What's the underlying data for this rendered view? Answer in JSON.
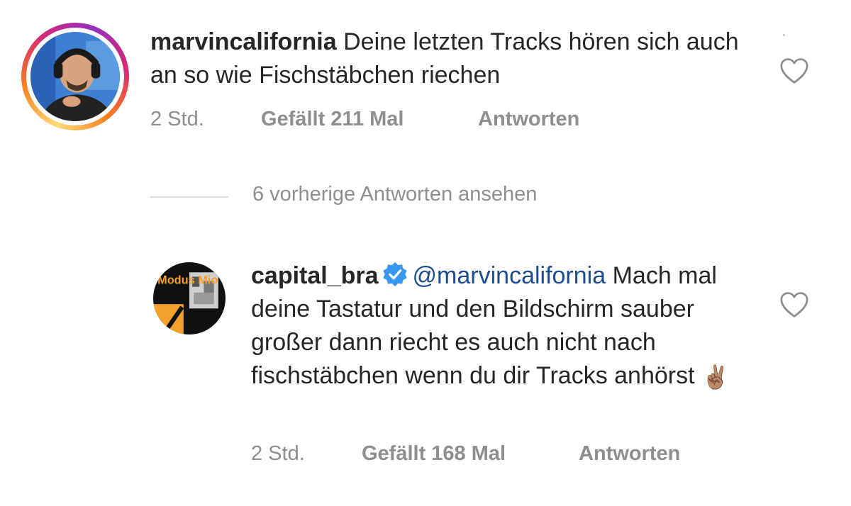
{
  "comments": [
    {
      "username": "marvincalifornia",
      "text": " Deine letzten Tracks hören sich auch an so wie Fischstäbchen riechen",
      "time": "2 Std.",
      "likes": "Gefällt 211 Mal",
      "reply": "Antworten",
      "avatar_icon": "profile-photo-man-headphones",
      "has_story_ring": true
    },
    {
      "username": "capital_bra",
      "verified": true,
      "mention": "@marvincalifornia",
      "text": " Mach mal deine Tastatur und den Bildschirm sauber großer dann riecht es auch nicht nach fischstäbchen wenn du dir Tracks anhörst ",
      "emoji": "✌🏽",
      "time": "2 Std.",
      "likes": "Gefällt 168 Mal",
      "reply": "Antworten",
      "avatar_icon": "album-cover-modus-mio",
      "avatar_text": "Modus Mio"
    }
  ],
  "view_replies": {
    "label": "6 vorherige Antworten ansehen"
  },
  "colors": {
    "text": "#262626",
    "muted": "#8e8e8e",
    "mention": "#1f4c8f",
    "verified": "#3897f0"
  }
}
